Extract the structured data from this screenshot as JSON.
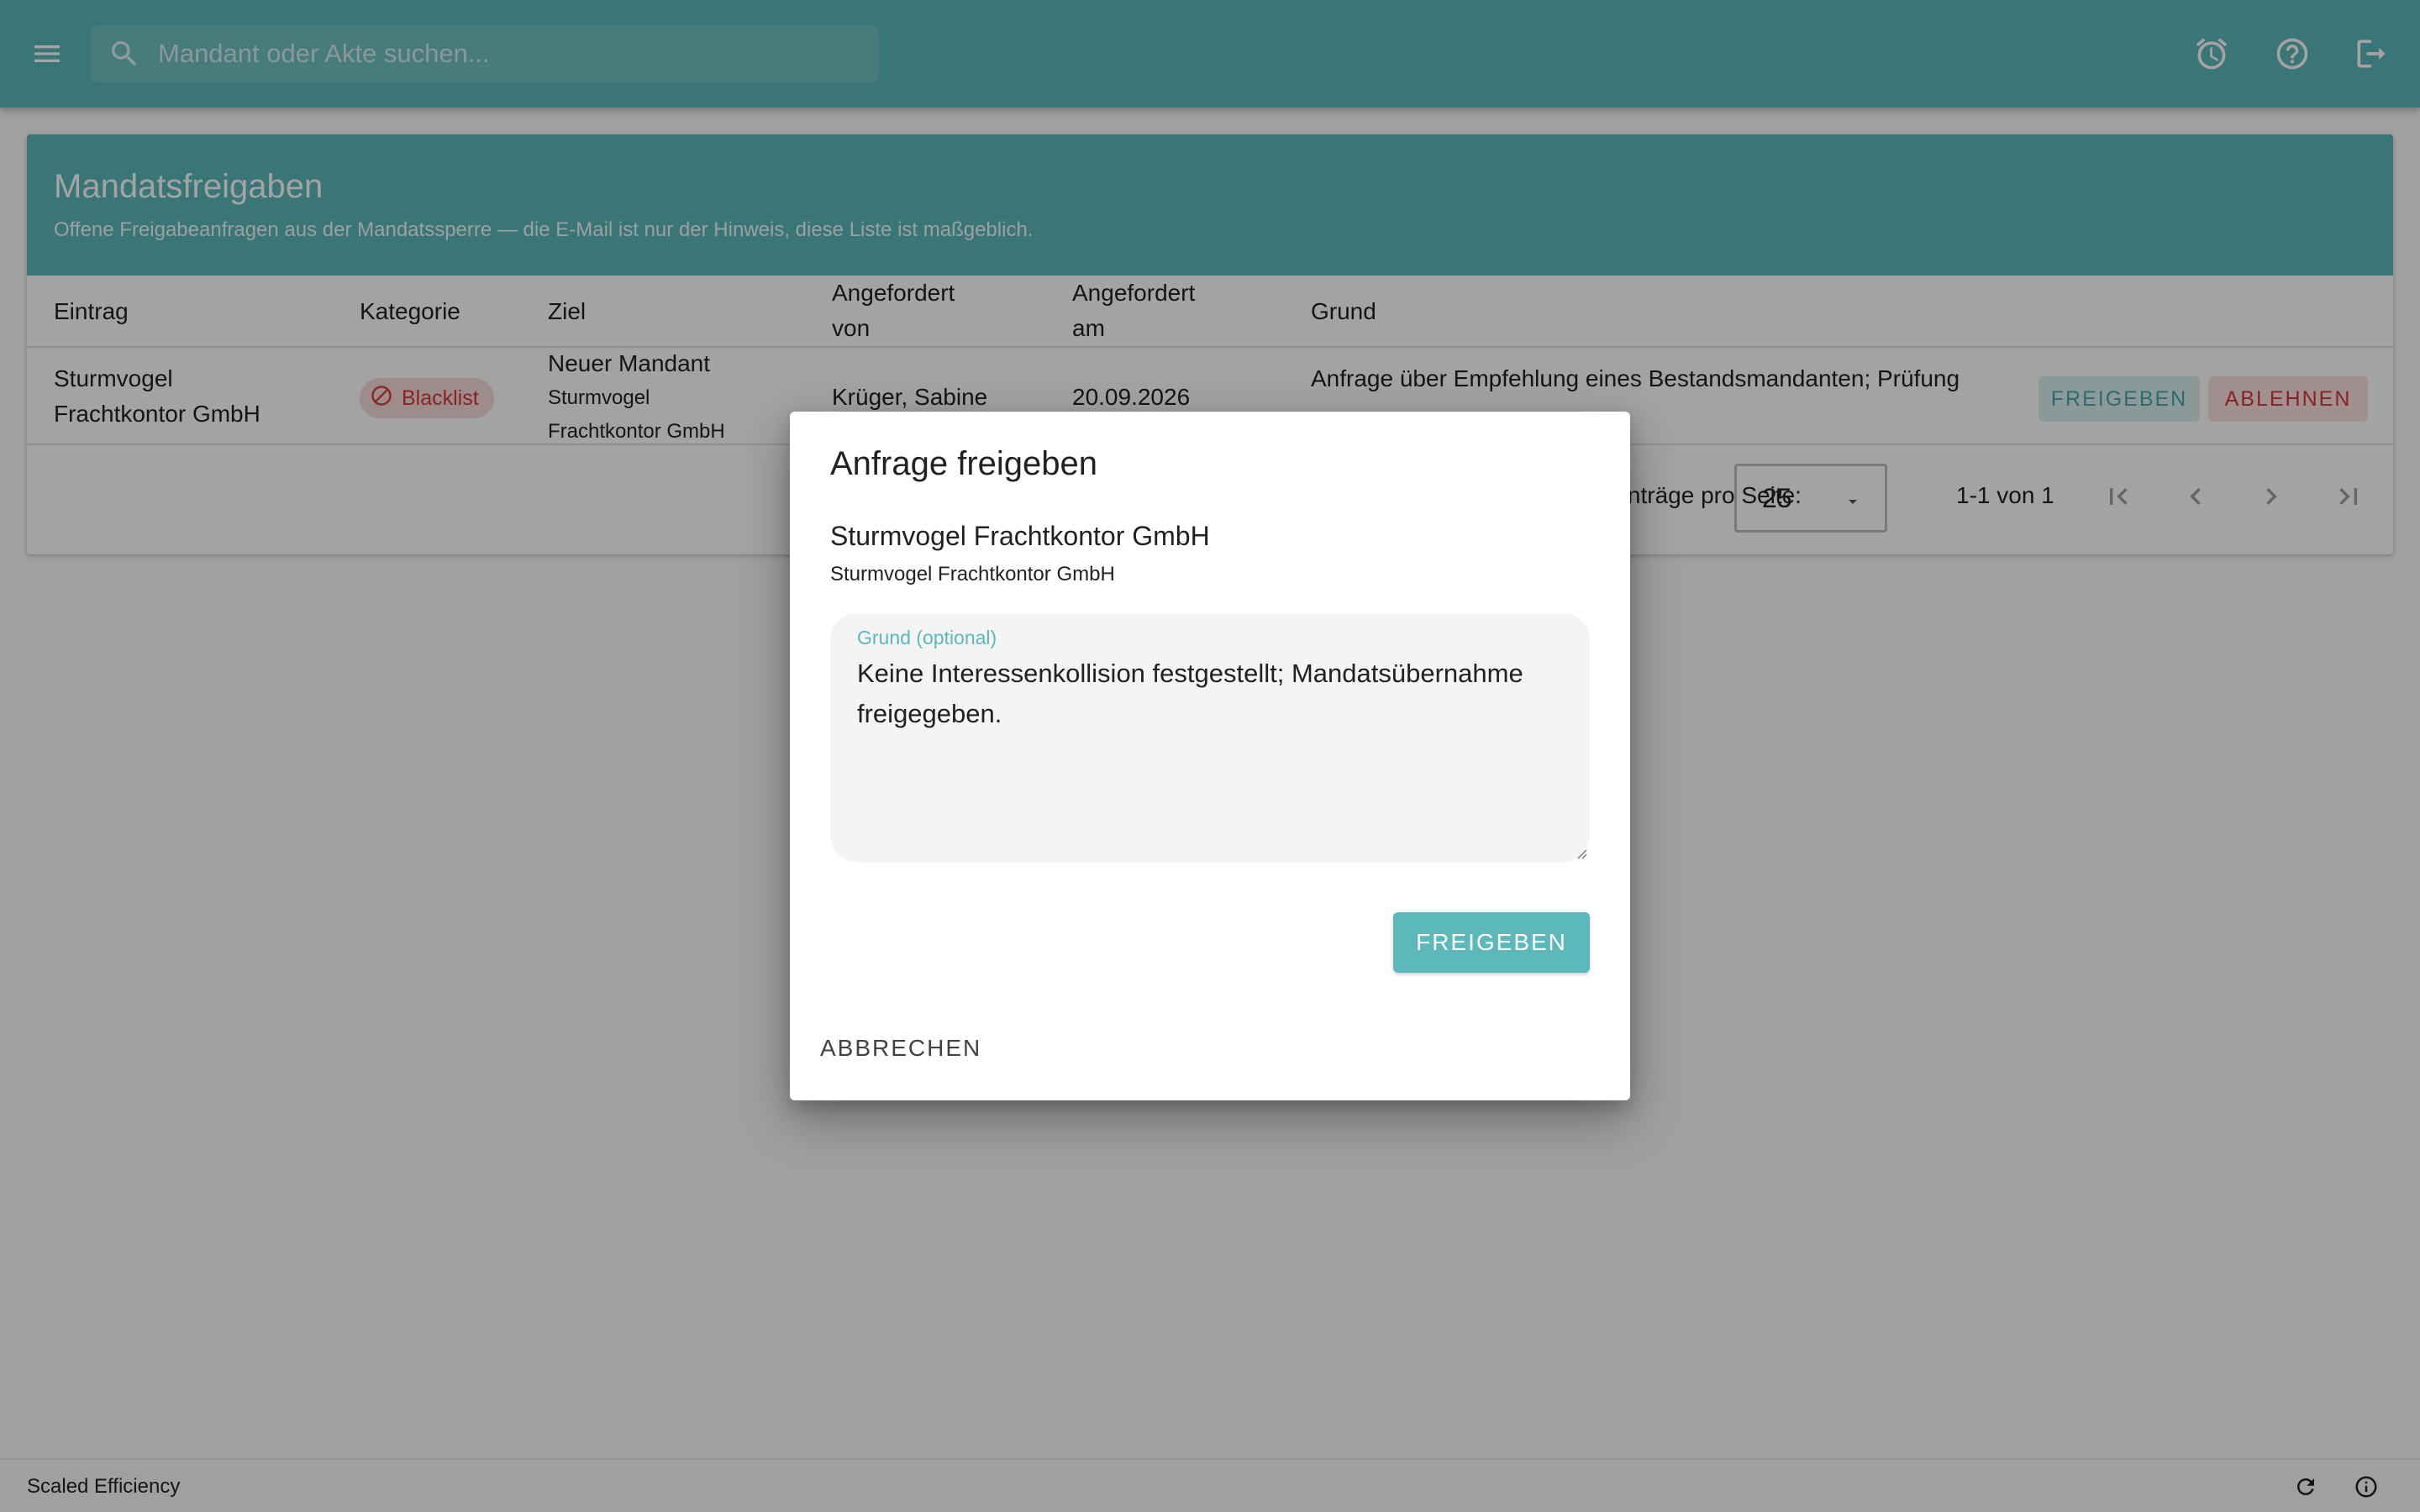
{
  "colors": {
    "primary": "#5cb8bb",
    "danger": "#d8373a",
    "chip_background": "#f8dada",
    "overlay": "rgba(0,0,0,0.36)"
  },
  "topbar": {
    "menu_icon": "menu-icon",
    "search": {
      "icon": "search-icon",
      "placeholder": "Mandant oder Akte suchen..."
    },
    "actions": [
      {
        "icon": "alarm-clock-icon"
      },
      {
        "icon": "help-circle-icon"
      },
      {
        "icon": "logout-icon"
      }
    ]
  },
  "card": {
    "title": "Mandatsfreigaben",
    "subtitle": "Offene Freigabeanfragen aus der Mandatssperre — die E-Mail ist nur der Hinweis, diese Liste ist maßgeblich."
  },
  "table": {
    "columns": {
      "entry": "Eintrag",
      "category": "Kategorie",
      "target": "Ziel",
      "requested_by_1": "Angefordert",
      "requested_by_2": "von",
      "requested_at_1": "Angefordert",
      "requested_at_2": "am",
      "reason": "Grund"
    },
    "rows": [
      {
        "entry_line1": "Sturmvogel",
        "entry_line2": "Frachtkontor GmbH",
        "category": "Blacklist",
        "category_icon": "block-icon",
        "target_title": "Neuer Mandant",
        "target_line1": "Sturmvogel",
        "target_line2": "Frachtkontor GmbH",
        "requested_by": "Krüger, Sabine",
        "requested_at": "20.09.2026",
        "reason": "Anfrage über Empfehlung eines Bestandsmandanten; Prüfung",
        "approve_label": "FREIGEBEN",
        "reject_label": "ABLEHNEN"
      }
    ]
  },
  "pagination": {
    "per_page_label": "Einträge pro Seite:",
    "per_page_value": "25",
    "range": "1-1 von 1",
    "buttons": [
      "first-page-icon",
      "previous-page-icon",
      "next-page-icon",
      "last-page-icon"
    ]
  },
  "dialog": {
    "title": "Anfrage freigeben",
    "client_name": "Sturmvogel Frachtkontor GmbH",
    "client_subtitle": "Sturmvogel Frachtkontor GmbH",
    "field_label": "Grund (optional)",
    "field_value": "Keine Interessenkollision festgestellt; Mandatsübernahme freigegeben.",
    "confirm_label": "FREIGEBEN",
    "cancel_label": "ABBRECHEN"
  },
  "footer": {
    "text": "Scaled Efficiency",
    "icons": [
      "refresh-icon",
      "info-icon"
    ]
  }
}
